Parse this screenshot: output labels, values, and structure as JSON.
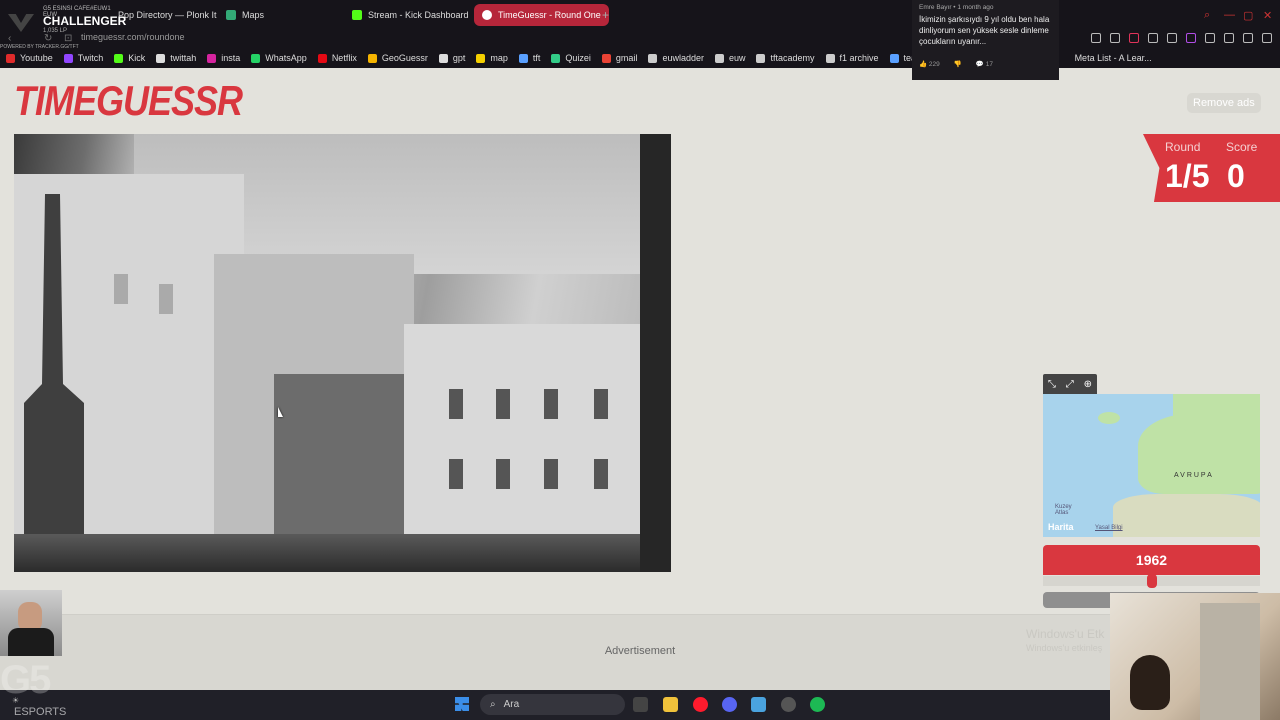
{
  "browser": {
    "tabs": [
      {
        "label": "Pop Directory — Plonk It",
        "color": "#666"
      },
      {
        "label": "Maps",
        "color": "#3a7"
      },
      {
        "label": "Stream - Kick Dashboard",
        "color": "#53fc18"
      },
      {
        "label": "TimeGuessr - Round One",
        "color": "#fff",
        "active": true
      }
    ],
    "new_tab": "+",
    "url": "timeguessr.com/roundone",
    "bookmarks": [
      {
        "label": "Youtube",
        "color": "#e02b2b"
      },
      {
        "label": "Twitch",
        "color": "#9146ff"
      },
      {
        "label": "Kick",
        "color": "#53fc18"
      },
      {
        "label": "twittah",
        "color": "#ddd"
      },
      {
        "label": "insta",
        "color": "#d6249f"
      },
      {
        "label": "WhatsApp",
        "color": "#25d366"
      },
      {
        "label": "Netflix",
        "color": "#e50914"
      },
      {
        "label": "GeoGuessr",
        "color": "#f5b400"
      },
      {
        "label": "gpt",
        "color": "#ddd"
      },
      {
        "label": "map",
        "color": "#f5d000"
      },
      {
        "label": "tft",
        "color": "#5aa0ff"
      },
      {
        "label": "Quizei",
        "color": "#3c8"
      },
      {
        "label": "gmail",
        "color": "#ea4335"
      },
      {
        "label": "euwladder",
        "color": "#ccc"
      },
      {
        "label": "euw",
        "color": "#ccc"
      },
      {
        "label": "tftacademy",
        "color": "#ccc"
      },
      {
        "label": "f1 archive",
        "color": "#ccc"
      },
      {
        "label": "team",
        "color": "#5aa0ff"
      }
    ],
    "bookmark_extra": "Meta List - A Lear..."
  },
  "stream_overlay": {
    "top_small": "G5 ESINSI CAFE#EUW1 EUW",
    "rank": "CHALLENGER",
    "lp": "1,035 LP",
    "powered": "POWERED BY TRACKER.GG/TFT"
  },
  "notification": {
    "meta": "Emre Bayır • 1 month ago",
    "text": "İkimizin şarkısıydı 9 yıl oldu ben hala dinliyorum sen yüksek sesle dinleme çocukların uyanır...",
    "likes": "229",
    "comments": "17"
  },
  "page": {
    "logo": "TIMEGUESSR",
    "remove_ads": "Remove ads",
    "round_label": "Round",
    "round_value": "1/5",
    "score_label": "Score",
    "score_value": "0",
    "map_label_region": "AVRUPA",
    "map_label_ocean": "Kuzey Atlas",
    "map_attribution": "Harita",
    "map_legal": "Yasal Bilgi",
    "year": "1962",
    "year_slider_fraction": 0.5,
    "place_button": "Place",
    "advertisement": "Advertisement",
    "windows_activate_1": "Windows'u Etk",
    "windows_activate_2": "Windows'u etkinleş"
  },
  "overlay_bottom": {
    "g5": "G5",
    "esports": "ESPORTS"
  },
  "taskbar": {
    "search_placeholder": "Ara"
  }
}
